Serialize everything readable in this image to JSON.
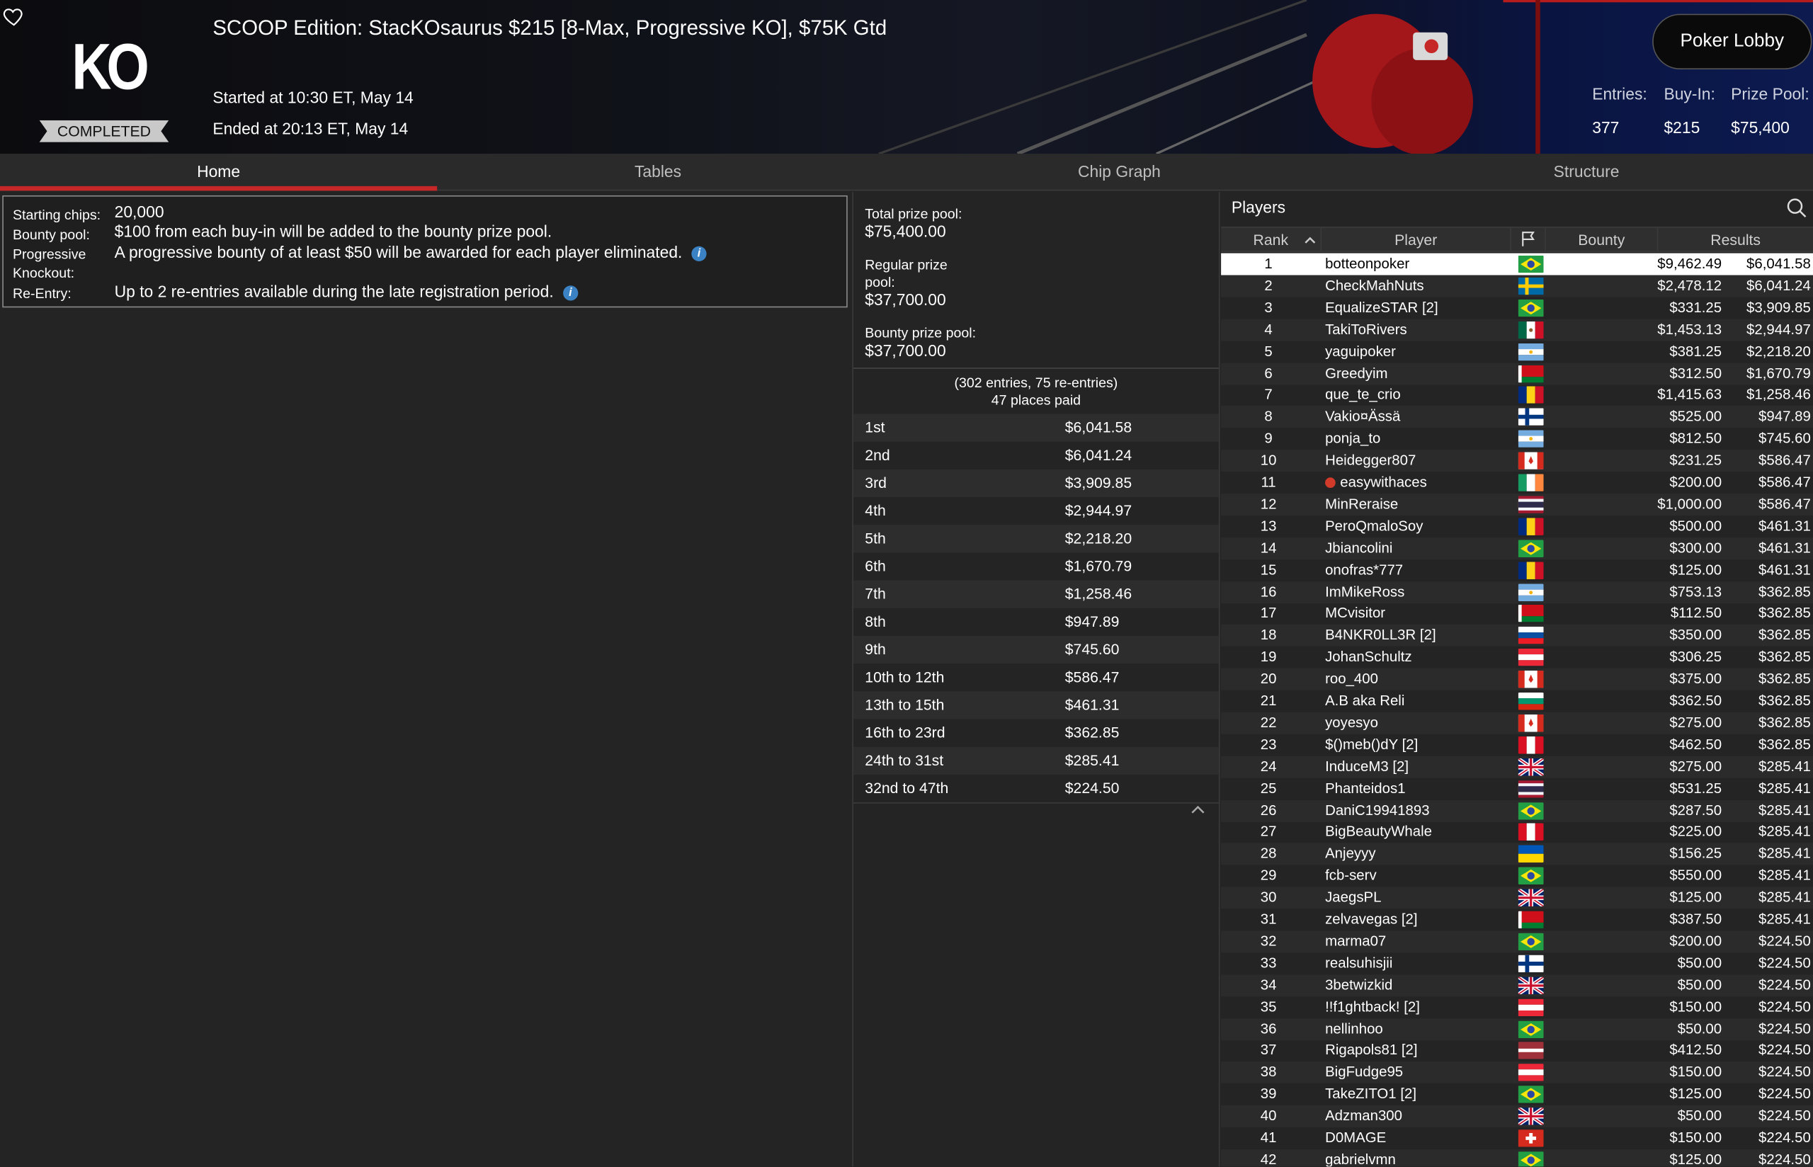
{
  "header": {
    "logo": "KO",
    "status": "COMPLETED",
    "title": "SCOOP Edition: StacKOsaurus $215 [8-Max, Progressive KO], $75K Gtd",
    "started": "Started at 10:30 ET, May 14",
    "ended": "Ended at 20:13 ET, May 14",
    "lobby_button": "Poker Lobby",
    "stats": {
      "entries_label": "Entries:",
      "entries": "377",
      "buyin_label": "Buy-In:",
      "buyin": "$215",
      "prizepool_label": "Prize Pool:",
      "prizepool": "$75,400"
    }
  },
  "tabs": [
    "Home",
    "Tables",
    "Chip Graph",
    "Structure"
  ],
  "info": {
    "starting_chips_label": "Starting chips:",
    "starting_chips": "20,000",
    "bounty_pool_label": "Bounty pool:",
    "bounty_pool": "$100 from each buy-in will be added to the bounty prize pool.",
    "progressive_label_1": "Progressive",
    "progressive_label_2": "Knockout:",
    "progressive": "A progressive bounty of at least $50 will be awarded for each player eliminated.",
    "reentry_label": "Re-Entry:",
    "reentry": "Up to 2 re-entries available during the late registration period.",
    "info_glyph": "i"
  },
  "prizepool": {
    "total_label": "Total prize pool:",
    "total": "$75,400.00",
    "regular_label_1": "Regular prize",
    "regular_label_2": "pool:",
    "regular": "$37,700.00",
    "bounty_label": "Bounty prize pool:",
    "bounty": "$37,700.00",
    "entries_line": "(302 entries, 75 re-entries)",
    "paid_line": "47 places paid",
    "payouts": [
      {
        "place": "1st",
        "amount": "$6,041.58"
      },
      {
        "place": "2nd",
        "amount": "$6,041.24"
      },
      {
        "place": "3rd",
        "amount": "$3,909.85"
      },
      {
        "place": "4th",
        "amount": "$2,944.97"
      },
      {
        "place": "5th",
        "amount": "$2,218.20"
      },
      {
        "place": "6th",
        "amount": "$1,670.79"
      },
      {
        "place": "7th",
        "amount": "$1,258.46"
      },
      {
        "place": "8th",
        "amount": "$947.89"
      },
      {
        "place": "9th",
        "amount": "$745.60"
      },
      {
        "place": "10th to 12th",
        "amount": "$586.47"
      },
      {
        "place": "13th to 15th",
        "amount": "$461.31"
      },
      {
        "place": "16th to 23rd",
        "amount": "$362.85"
      },
      {
        "place": "24th to 31st",
        "amount": "$285.41"
      },
      {
        "place": "32nd to 47th",
        "amount": "$224.50"
      }
    ]
  },
  "players": {
    "title": "Players",
    "columns": [
      "Rank",
      "Player",
      "Bounty",
      "Results"
    ],
    "rows": [
      {
        "rank": "1",
        "name": "botteonpoker",
        "flag": "br",
        "bounty": "$9,462.49",
        "result": "$6,041.58"
      },
      {
        "rank": "2",
        "name": "CheckMahNuts",
        "flag": "se",
        "bounty": "$2,478.12",
        "result": "$6,041.24"
      },
      {
        "rank": "3",
        "name": "EqualizeSTAR [2]",
        "flag": "br",
        "bounty": "$331.25",
        "result": "$3,909.85"
      },
      {
        "rank": "4",
        "name": "TakiToRivers",
        "flag": "mx",
        "bounty": "$1,453.13",
        "result": "$2,944.97"
      },
      {
        "rank": "5",
        "name": "yaguipoker",
        "flag": "ar",
        "bounty": "$381.25",
        "result": "$2,218.20"
      },
      {
        "rank": "6",
        "name": "Greedyim",
        "flag": "by",
        "bounty": "$312.50",
        "result": "$1,670.79"
      },
      {
        "rank": "7",
        "name": "que_te_crio",
        "flag": "ro",
        "bounty": "$1,415.63",
        "result": "$1,258.46"
      },
      {
        "rank": "8",
        "name": "Vakio¤Ässä",
        "flag": "fi",
        "bounty": "$525.00",
        "result": "$947.89"
      },
      {
        "rank": "9",
        "name": "ponja_to",
        "flag": "ar",
        "bounty": "$812.50",
        "result": "$745.60"
      },
      {
        "rank": "10",
        "name": "Heidegger807",
        "flag": "ca",
        "bounty": "$231.25",
        "result": "$586.47"
      },
      {
        "rank": "11",
        "name": "easywithaces",
        "flag": "ie",
        "bounty": "$200.00",
        "result": "$586.47",
        "pro": true
      },
      {
        "rank": "12",
        "name": "MinReraise",
        "flag": "th",
        "bounty": "$1,000.00",
        "result": "$586.47"
      },
      {
        "rank": "13",
        "name": "PeroQmaloSoy",
        "flag": "ro",
        "bounty": "$500.00",
        "result": "$461.31"
      },
      {
        "rank": "14",
        "name": "Jbiancolini",
        "flag": "br",
        "bounty": "$300.00",
        "result": "$461.31"
      },
      {
        "rank": "15",
        "name": "onofras*777",
        "flag": "ro",
        "bounty": "$125.00",
        "result": "$461.31"
      },
      {
        "rank": "16",
        "name": "ImMikeRoss",
        "flag": "ar",
        "bounty": "$753.13",
        "result": "$362.85"
      },
      {
        "rank": "17",
        "name": "MCvisitor",
        "flag": "by",
        "bounty": "$112.50",
        "result": "$362.85"
      },
      {
        "rank": "18",
        "name": "B4NKR0LL3R [2]",
        "flag": "sk",
        "bounty": "$350.00",
        "result": "$362.85"
      },
      {
        "rank": "19",
        "name": "JohanSchultz",
        "flag": "at",
        "bounty": "$306.25",
        "result": "$362.85"
      },
      {
        "rank": "20",
        "name": "roo_400",
        "flag": "ca",
        "bounty": "$375.00",
        "result": "$362.85"
      },
      {
        "rank": "21",
        "name": "A.B aka Reli",
        "flag": "bg",
        "bounty": "$362.50",
        "result": "$362.85"
      },
      {
        "rank": "22",
        "name": "yoyesyo",
        "flag": "ca",
        "bounty": "$275.00",
        "result": "$362.85"
      },
      {
        "rank": "23",
        "name": "$()meb()dY [2]",
        "flag": "pe",
        "bounty": "$462.50",
        "result": "$362.85"
      },
      {
        "rank": "24",
        "name": "InduceM3 [2]",
        "flag": "gb",
        "bounty": "$275.00",
        "result": "$285.41"
      },
      {
        "rank": "25",
        "name": "Phanteidos1",
        "flag": "th",
        "bounty": "$531.25",
        "result": "$285.41"
      },
      {
        "rank": "26",
        "name": "DaniC19941893",
        "flag": "br",
        "bounty": "$287.50",
        "result": "$285.41"
      },
      {
        "rank": "27",
        "name": "BigBeautyWhale",
        "flag": "pe",
        "bounty": "$225.00",
        "result": "$285.41"
      },
      {
        "rank": "28",
        "name": "Anjeyyy",
        "flag": "ua",
        "bounty": "$156.25",
        "result": "$285.41"
      },
      {
        "rank": "29",
        "name": "fcb-serv",
        "flag": "br",
        "bounty": "$550.00",
        "result": "$285.41"
      },
      {
        "rank": "30",
        "name": "JaegsPL",
        "flag": "gb",
        "bounty": "$125.00",
        "result": "$285.41"
      },
      {
        "rank": "31",
        "name": "zelvavegas [2]",
        "flag": "by",
        "bounty": "$387.50",
        "result": "$285.41"
      },
      {
        "rank": "32",
        "name": "marma07",
        "flag": "br",
        "bounty": "$200.00",
        "result": "$224.50"
      },
      {
        "rank": "33",
        "name": "realsuhisjii",
        "flag": "fi",
        "bounty": "$50.00",
        "result": "$224.50"
      },
      {
        "rank": "34",
        "name": "3betwizkid",
        "flag": "gb",
        "bounty": "$50.00",
        "result": "$224.50"
      },
      {
        "rank": "35",
        "name": "!!f1ghtback! [2]",
        "flag": "at",
        "bounty": "$150.00",
        "result": "$224.50"
      },
      {
        "rank": "36",
        "name": "nellinhoo",
        "flag": "br",
        "bounty": "$50.00",
        "result": "$224.50"
      },
      {
        "rank": "37",
        "name": "Rigapols81 [2]",
        "flag": "lv",
        "bounty": "$412.50",
        "result": "$224.50"
      },
      {
        "rank": "38",
        "name": "BigFudge95",
        "flag": "at",
        "bounty": "$150.00",
        "result": "$224.50"
      },
      {
        "rank": "39",
        "name": "TakeZITO1 [2]",
        "flag": "br",
        "bounty": "$125.00",
        "result": "$224.50"
      },
      {
        "rank": "40",
        "name": "Adzman300",
        "flag": "gb",
        "bounty": "$50.00",
        "result": "$224.50"
      },
      {
        "rank": "41",
        "name": "D0MAGE",
        "flag": "ch",
        "bounty": "$150.00",
        "result": "$224.50"
      },
      {
        "rank": "42",
        "name": "gabrielvmn",
        "flag": "br",
        "bounty": "$125.00",
        "result": "$224.50"
      }
    ]
  },
  "colors": {
    "accent": "#c62828",
    "background": "#242424",
    "info": "#3b82c4"
  }
}
